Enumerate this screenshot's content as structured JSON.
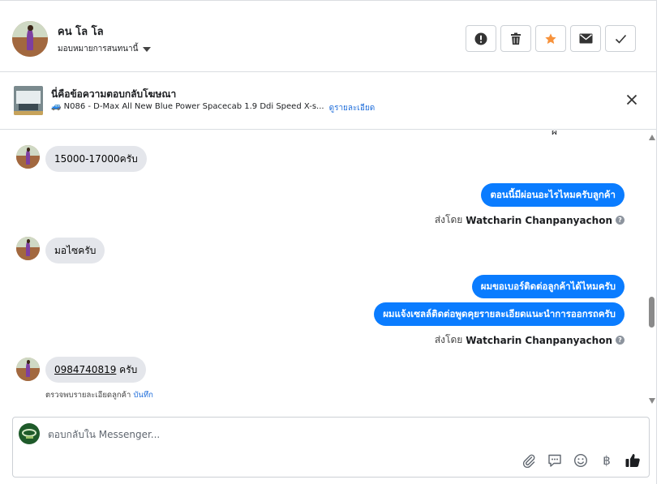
{
  "header": {
    "name": "คน โล โล",
    "assign_label": "มอบหมายการสนทนานี้",
    "actions": [
      {
        "icon": "alert-icon",
        "label": "Mark as spam"
      },
      {
        "icon": "trash-icon",
        "label": "Delete"
      },
      {
        "icon": "star-icon",
        "label": "Star",
        "color": "#f7923b"
      },
      {
        "icon": "mail-icon",
        "label": "Mark unread"
      },
      {
        "icon": "check-icon",
        "label": "Done"
      }
    ]
  },
  "ad": {
    "title": "นี่คือข้อความตอบกลับโฆษณา",
    "description": "N086 - D-Max All New Blue Power Spacecab 1.9 Ddi Speed X-s...",
    "link": "ดูรายละเอียด"
  },
  "messages": {
    "m1": "15000-17000ครับ",
    "m2": "ตอนนี้มีผ่อนอะไรไหมครับลูกค้า",
    "m3": "มอไซครับ",
    "m4": "ผมขอเบอร์ติดต่อลูกค้าได้ไหมครับ",
    "m5": "ผมแจ้งเซลล์ติดต่อพูดคุยรายละเอียดแนะนำการออกรถครับ",
    "m6_phone": "0984740819",
    "m6_suffix": " ครับ",
    "sent_by_label": "ส่งโดย",
    "sender": "Watcharin Chanpanyachon",
    "detail_note": "ตรวจพบรายละเอียดลูกค้า",
    "detail_link": "บันทึก"
  },
  "composer": {
    "placeholder": "ตอบกลับใน Messenger...",
    "tools": [
      "attachment-icon",
      "saved-reply-icon",
      "emoji-icon",
      "baht-icon",
      "like-icon"
    ],
    "baht_symbol": "฿"
  },
  "colors": {
    "accent": "#0a7cff",
    "link": "#216fdb",
    "incoming_bubble": "#e4e6eb"
  }
}
